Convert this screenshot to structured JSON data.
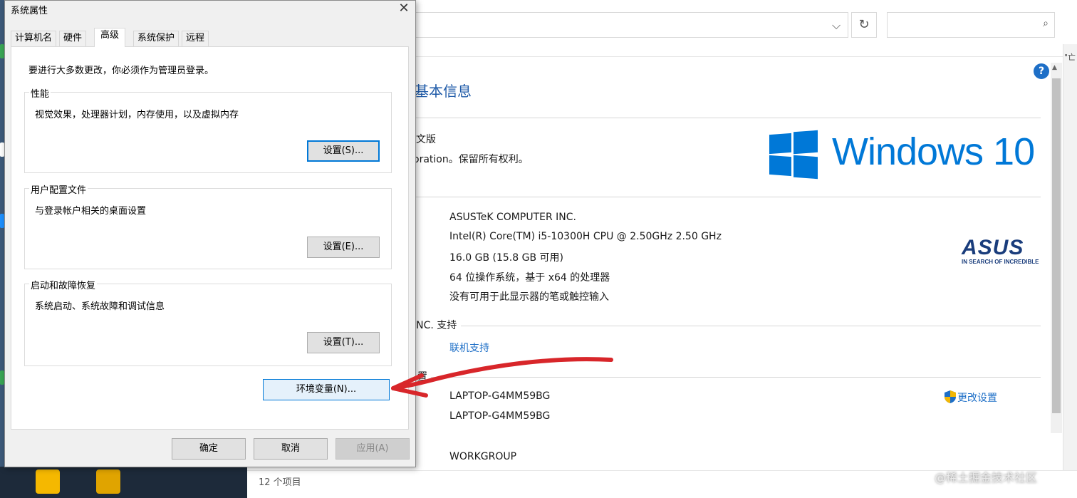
{
  "colors": {
    "accent": "#0078d7",
    "link": "#1e6fc7",
    "asus": "#1a3d7c",
    "arrow": "#d8262a"
  },
  "dialog": {
    "title": "系统属性",
    "close_glyph": "✕",
    "tabs": [
      "计算机名",
      "硬件",
      "高级",
      "系统保护",
      "远程"
    ],
    "active_tab": "高级",
    "intro": "要进行大多数更改，你必须作为管理员登录。",
    "groups": [
      {
        "label": "性能",
        "desc": "视觉效果，处理器计划，内存使用，以及虚拟内存",
        "button": "设置(S)..."
      },
      {
        "label": "用户配置文件",
        "desc": "与登录帐户相关的桌面设置",
        "button": "设置(E)..."
      },
      {
        "label": "启动和故障恢复",
        "desc": "系统启动、系统故障和调试信息",
        "button": "设置(T)..."
      }
    ],
    "env_button": "环境变量(N)...",
    "ok": "确定",
    "cancel": "取消",
    "apply": "应用(A)"
  },
  "system": {
    "page_title": "基本信息",
    "edition_partial": "文版",
    "copyright_partial": "oration。保留所有权利。",
    "windows_logo_text": "Windows 10",
    "manufacturer": "ASUSTeK COMPUTER INC.",
    "processor": "Intel(R) Core(TM) i5-10300H CPU @ 2.50GHz   2.50 GHz",
    "ram_label_partial": ":",
    "ram": "16.0 GB (15.8 GB 可用)",
    "system_type": "64 位操作系统，基于 x64 的处理器",
    "pen_touch": "没有可用于此显示器的笔或触控输入",
    "support_header_partial": "INC. 支持",
    "online_support": "联机支持",
    "computer_section_partial": "置",
    "computer_name": "LAPTOP-G4MM59BG",
    "full_computer_name": "LAPTOP-G4MM59BG",
    "workgroup": "WORKGROUP",
    "change_settings": "更改设置",
    "asus_logo": "ASUS",
    "asus_tagline": "IN SEARCH OF INCREDIBLE",
    "help_glyph": "?",
    "edge_text": "\"亡",
    "count_partial": "12 个项目"
  },
  "toolbar": {
    "dropdown_glyph": "⌵",
    "refresh_glyph": "↻",
    "search_glyph": "⌕"
  },
  "watermark": "@稀土掘金技术社区"
}
